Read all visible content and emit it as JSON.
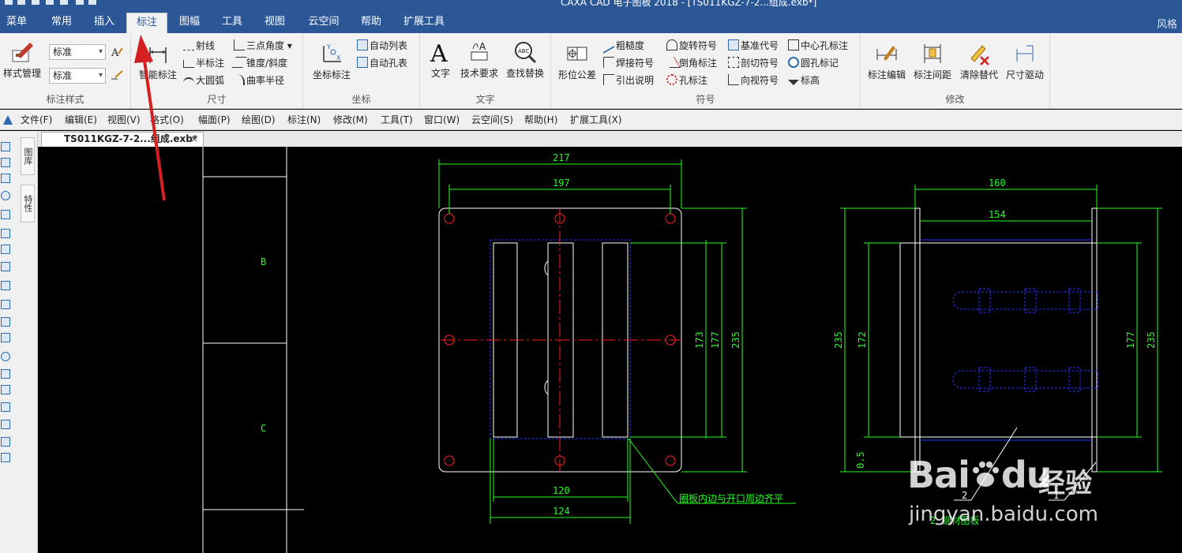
{
  "window": {
    "title": "CAXA CAD 电子图板 2018 - [TS011KGZ-7-2...组成.exb*]",
    "theme_label": "风格"
  },
  "ribbon_tabs": [
    "菜单",
    "常用",
    "插入",
    "标注",
    "图幅",
    "工具",
    "视图",
    "云空间",
    "帮助",
    "扩展工具"
  ],
  "active_tab": "标注",
  "ribbon": {
    "style_group": {
      "label": "标注样式",
      "style_manager": "样式管理",
      "combo1": "标准",
      "combo2": "标准"
    },
    "dimension_group": {
      "label": "尺寸",
      "smart_dim": "智能标注",
      "items": [
        "射线",
        "半标注",
        "大圆弧",
        "三点角度",
        "锥度/斜度",
        "曲率半径"
      ]
    },
    "coordinate_group": {
      "label": "坐标",
      "coord_dim": "坐标标注",
      "items": [
        "自动列表",
        "自动孔表"
      ]
    },
    "text_group": {
      "label": "文字",
      "text": "文字",
      "tech_req": "技术要求",
      "find_replace": "查找替换"
    },
    "symbol_group": {
      "label": "符号",
      "form_tol": "形位公差",
      "items": [
        "粗糙度",
        "焊接符号",
        "引出说明",
        "旋转符号",
        "倒角标注",
        "孔标注",
        "基准代号",
        "剖切符号",
        "向视符号",
        "中心孔标注",
        "圆孔标记",
        "标高"
      ]
    },
    "modify_group": {
      "label": "修改",
      "items": [
        "标注编辑",
        "标注间距",
        "清除替代",
        "尺寸驱动"
      ]
    }
  },
  "menubar": [
    "文件(F)",
    "编辑(E)",
    "视图(V)",
    "格式(O)",
    "幅面(P)",
    "绘图(D)",
    "标注(N)",
    "修改(M)",
    "工具(T)",
    "窗口(W)",
    "云空间(S)",
    "帮助(H)",
    "扩展工具(X)"
  ],
  "document_tab": {
    "name": "TS011KGZ-7-2...组成.exb*",
    "close": "×"
  },
  "side_panels": [
    "图库",
    "特性"
  ],
  "drawing": {
    "zone_labels": [
      "B",
      "C"
    ],
    "dims_front": [
      "217",
      "197",
      "173",
      "177",
      "235",
      "120",
      "124"
    ],
    "dims_side": [
      "160",
      "154",
      "235",
      "172",
      "177",
      "235",
      "0.5"
    ],
    "note": "圈板内边与开口周边齐平",
    "balloons": [
      "2",
      "1"
    ],
    "bottom_label": "2 钢材图板"
  },
  "watermark": {
    "brand": "Bai",
    "brand2": "du",
    "jingyan": "经验",
    "url": "jingyan.baidu.com"
  },
  "colors": {
    "title_bar": "#2b5797",
    "ribbon_bg": "#f2f2f2",
    "drawing_bg": "#000000",
    "dim_green": "#22ff22",
    "outline_white": "#ffffff",
    "center_red": "#ff2020",
    "hidden_blue": "#2233ff",
    "annotation_arrow": "#d42020"
  }
}
